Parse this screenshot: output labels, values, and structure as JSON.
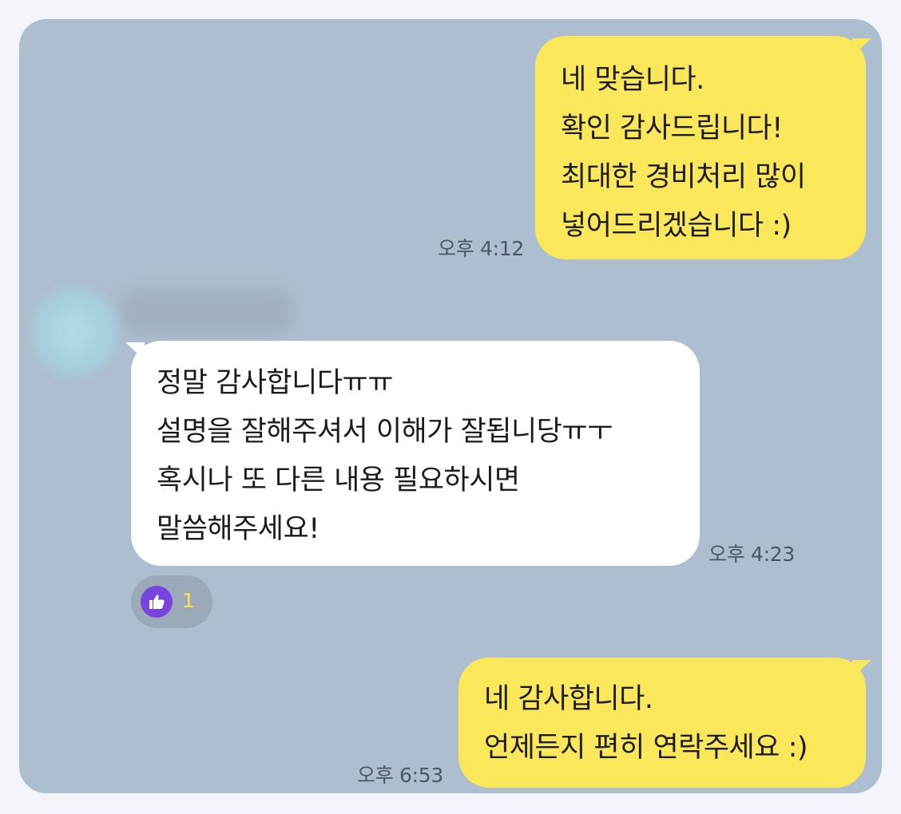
{
  "messages": [
    {
      "direction": "sent",
      "lines": [
        "네 맞습니다.",
        "확인 감사드립니다!",
        "최대한 경비처리 많이",
        "넣어드리겠습니다 :)"
      ],
      "time": "오후 4:12"
    },
    {
      "direction": "received",
      "lines": [
        "정말 감사합니다ㅠㅠ",
        "설명을 잘해주셔서 이해가 잘됩니당ㅠㅜ",
        "혹시나 또 다른 내용 필요하시면",
        "말씀해주세요!"
      ],
      "time": "오후 4:23",
      "reaction": {
        "icon": "thumbs-up-icon",
        "count": "1"
      }
    },
    {
      "direction": "sent",
      "lines": [
        "네 감사합니다.",
        "언제든지 편히 연락주세요 :)"
      ],
      "time": "오후 6:53"
    }
  ],
  "colors": {
    "chat_background": "#acbecf",
    "sent_bubble": "#fbe75a",
    "received_bubble": "#ffffff",
    "reaction_icon": "#7744e0",
    "reaction_count": "#f7e34e"
  }
}
